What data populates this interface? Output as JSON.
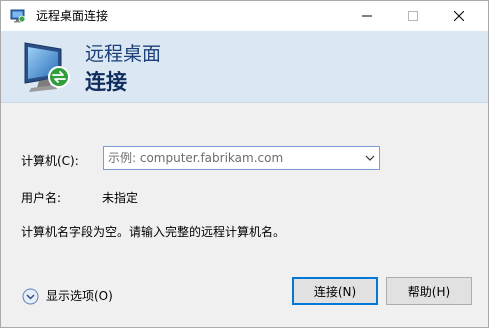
{
  "window": {
    "title": "远程桌面连接"
  },
  "banner": {
    "line1": "远程桌面",
    "line2": "连接"
  },
  "form": {
    "computer_label": "计算机(C):",
    "computer_placeholder": "示例: computer.fabrikam.com",
    "user_label": "用户名:",
    "user_value": "未指定",
    "message": "计算机名字段为空。请输入完整的远程计算机名。"
  },
  "footer": {
    "show_options_label": "显示选项(O)",
    "connect_label": "连接(N)",
    "help_label": "帮助(H)"
  },
  "icons": {
    "app": "remote-desktop-icon",
    "banner": "remote-desktop-monitor-icon",
    "dropdown": "chevron-down-icon",
    "options": "expand-circle-icon",
    "minimize": "minimize-icon",
    "maximize": "maximize-icon",
    "close": "close-icon"
  },
  "colors": {
    "banner_bg": "#dbe8f3",
    "title_blue": "#1b3f78",
    "default_button_border": "#0078d7"
  }
}
